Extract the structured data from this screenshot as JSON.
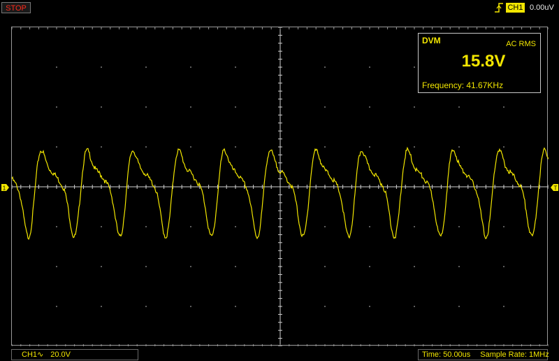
{
  "status": {
    "run_state": "STOP"
  },
  "trigger": {
    "source": "CH1",
    "level": "0.00uV",
    "edge_icon": "rising-edge-icon",
    "color": "#f2e600"
  },
  "dvm": {
    "title": "DVM",
    "mode": "AC RMS",
    "value": "15.8V",
    "frequency_label": "Frequency: 41.67KHz"
  },
  "channel": {
    "label": "CH1",
    "coupling_icon": "ac-coupling-icon",
    "coupling_symbol": "∿",
    "scale": "20.0V",
    "color": "#f2e600"
  },
  "timebase": {
    "time_label": "Time: 50.00us",
    "sample_rate_label": "Sample Rate: 1MHz"
  },
  "markers": {
    "channel_marker": "1",
    "trigger_marker": "T"
  },
  "colors": {
    "trace": "#f2e600",
    "stop": "#ff2a1a",
    "grid": "#bdbdbd",
    "background": "#000000"
  }
}
